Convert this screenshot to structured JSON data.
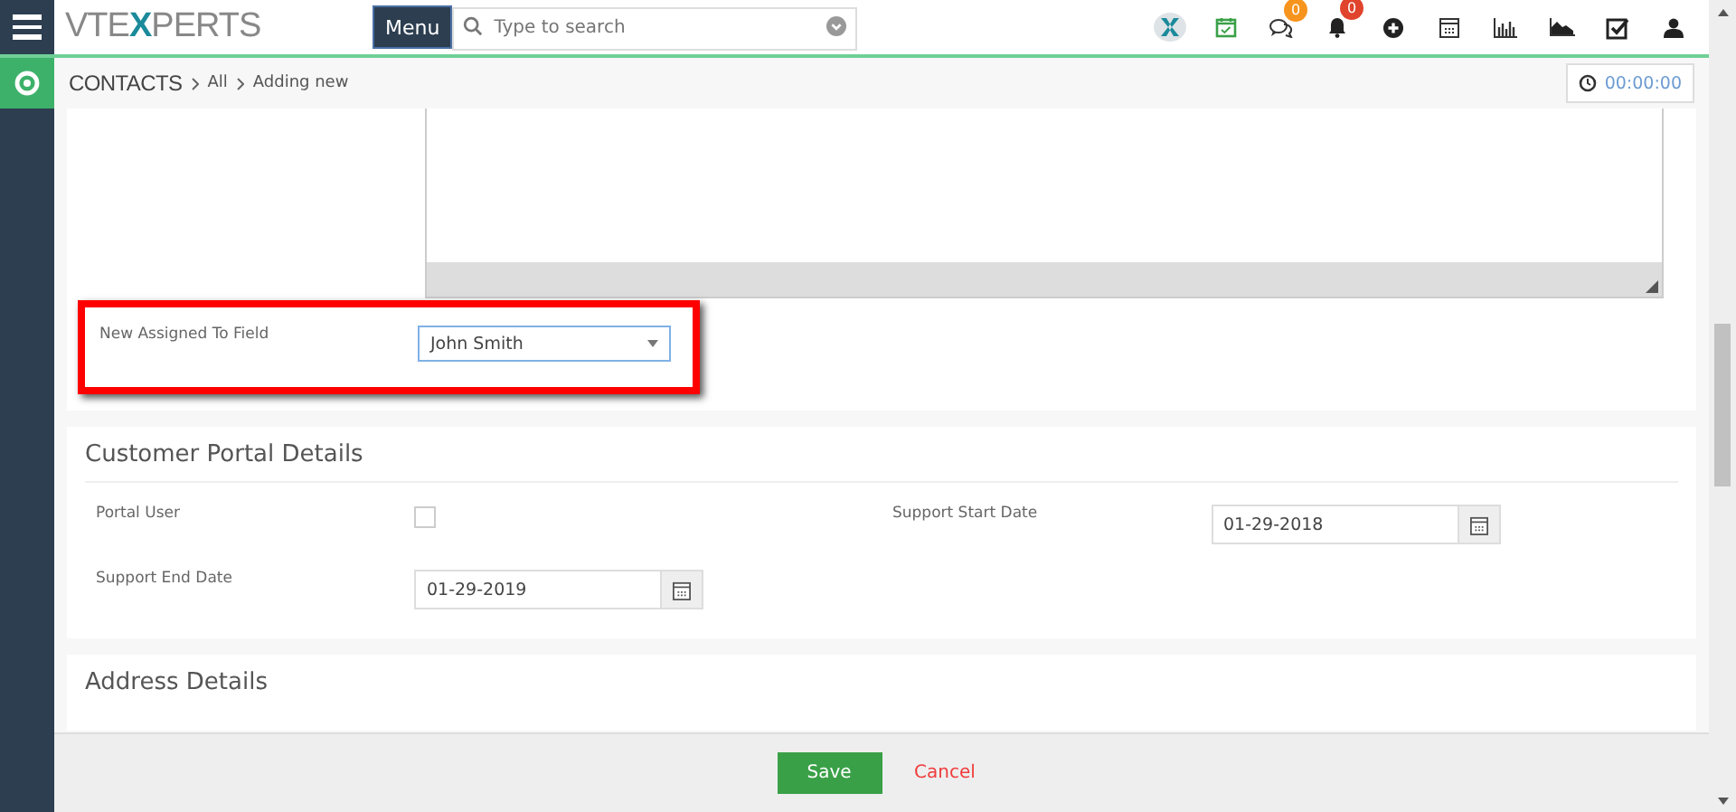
{
  "logo": {
    "parts": [
      "VTE",
      "X",
      "PERTS"
    ]
  },
  "menu_button": "Menu",
  "search": {
    "placeholder": "Type to search"
  },
  "toolbar": [
    {
      "kind": "brand"
    },
    {
      "kind": "calendar-check"
    },
    {
      "kind": "chat",
      "badge": "0",
      "color": "#f7941d"
    },
    {
      "kind": "bell",
      "badge": "0",
      "color": "#e0442c"
    },
    {
      "kind": "plus"
    },
    {
      "kind": "calendar"
    },
    {
      "kind": "bar-chart"
    },
    {
      "kind": "area-chart"
    },
    {
      "kind": "checkbox"
    },
    {
      "kind": "user"
    }
  ],
  "breadcrumb": [
    "CONTACTS",
    "All",
    "Adding new"
  ],
  "timer": "00:00:00",
  "assigned_field": {
    "label": "New Assigned To Field",
    "value": "John Smith",
    "highlighted": true
  },
  "sections": [
    {
      "title": "Customer Portal Details",
      "fields": [
        {
          "kind": "checkbox",
          "label": "Portal User",
          "checked": false
        },
        {
          "kind": "date",
          "label": "Support Start Date",
          "value": "01-29-2018"
        },
        {
          "kind": "date",
          "label": "Support End Date",
          "value": "01-29-2019"
        }
      ]
    },
    {
      "title": "Address Details"
    }
  ],
  "footer": {
    "save": "Save",
    "cancel": "Cancel"
  }
}
